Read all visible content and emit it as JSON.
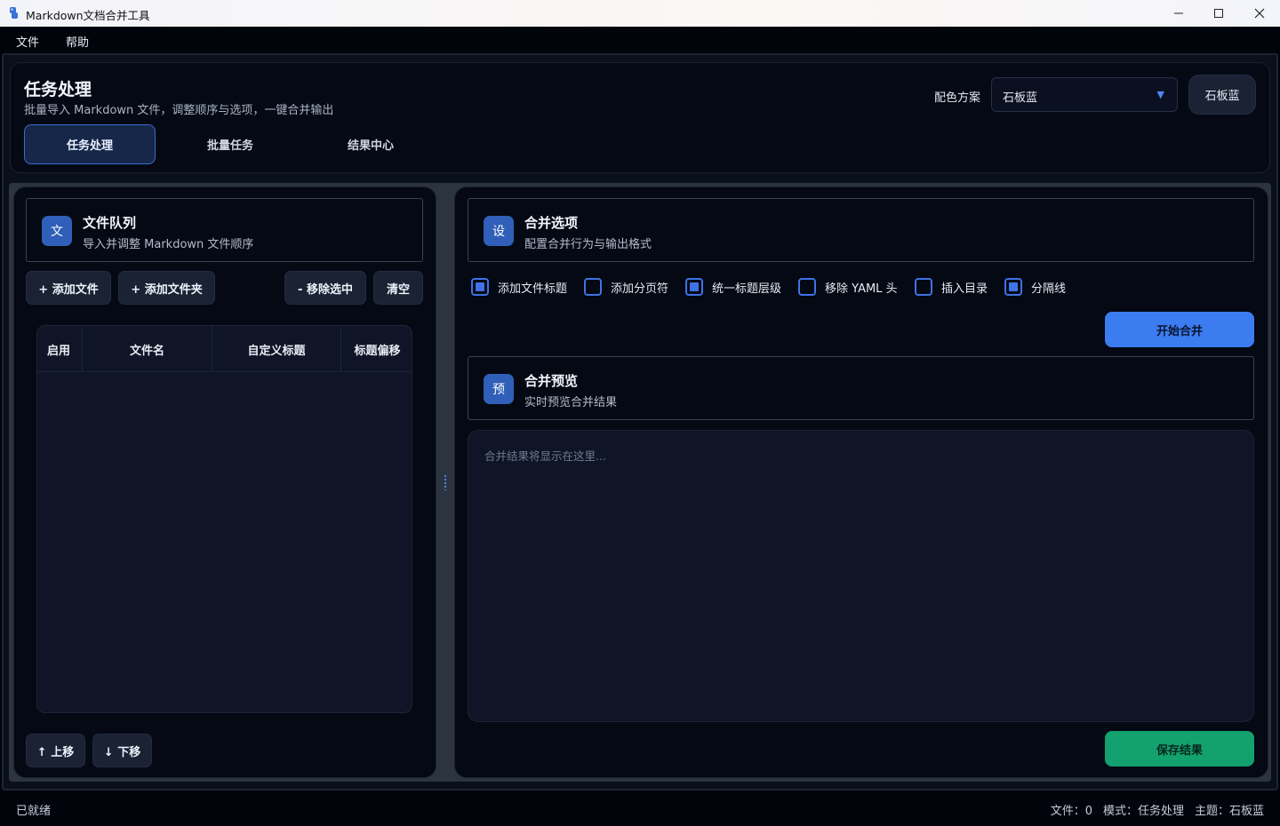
{
  "window": {
    "title": "Markdown文档合并工具"
  },
  "menu": {
    "file": "文件",
    "help": "帮助"
  },
  "header": {
    "title": "任务处理",
    "subtitle": "批量导入 Markdown 文件，调整顺序与选项，一键合并输出",
    "theme_label": "配色方案",
    "theme_selected": "石板蓝",
    "theme_button": "石板蓝",
    "tabs": [
      {
        "label": "任务处理",
        "active": true
      },
      {
        "label": "批量任务",
        "active": false
      },
      {
        "label": "结果中心",
        "active": false
      }
    ]
  },
  "queue": {
    "icon_char": "文",
    "title": "文件队列",
    "subtitle": "导入并调整 Markdown 文件顺序",
    "add_file": "+ 添加文件",
    "add_folder": "+ 添加文件夹",
    "remove_selected": "- 移除选中",
    "clear": "清空",
    "columns": [
      "启用",
      "文件名",
      "自定义标题",
      "标题偏移"
    ],
    "move_up": "↑ 上移",
    "move_down": "↓ 下移"
  },
  "options": {
    "icon_char": "设",
    "title": "合并选项",
    "subtitle": "配置合并行为与输出格式",
    "checkboxes": [
      {
        "label": "添加文件标题",
        "checked": true
      },
      {
        "label": "添加分页符",
        "checked": false
      },
      {
        "label": "统一标题层级",
        "checked": true
      },
      {
        "label": "移除 YAML 头",
        "checked": false
      },
      {
        "label": "插入目录",
        "checked": false
      },
      {
        "label": "分隔线",
        "checked": true
      }
    ],
    "start_button": "开始合并"
  },
  "preview": {
    "icon_char": "预",
    "title": "合并预览",
    "subtitle": "实时预览合并结果",
    "placeholder": "合并结果将显示在这里...",
    "save_button": "保存结果"
  },
  "status": {
    "left": "已就绪",
    "files": "文件：0",
    "mode": "模式：任务处理",
    "theme": "主题：石板蓝"
  },
  "colors": {
    "accent": "#3b7cf0",
    "success": "#13a16f",
    "background": "#050913"
  }
}
